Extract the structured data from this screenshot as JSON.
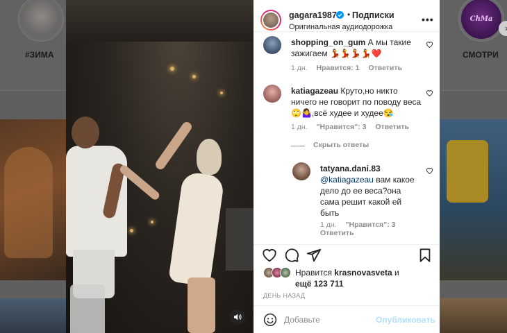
{
  "background": {
    "story_left_label": "#ЗИМА",
    "story_right_label": "СМОТРИ",
    "story_right_logo": "ChMa",
    "next_arrow": "›"
  },
  "post": {
    "author": "gagara1987",
    "separator": "•",
    "follow_label": "Подписки",
    "audio_label": "Оригинальная аудиодорожка",
    "more_label": "•••"
  },
  "comments": [
    {
      "username": "shopping_on_gum",
      "text": "А мы такие зажигаем 💃💃💃💃❤️",
      "time": "1 дн.",
      "likes": "Нравится: 1",
      "reply": "Ответить"
    },
    {
      "username": "katiagazeau",
      "text": "Круто,но никто ничего не говорит по поводу веса🙄🤷‍♀️,всё худее и худее😪",
      "time": "1 дн.",
      "likes": "\"Нравится\": 3",
      "reply": "Ответить"
    }
  ],
  "hide_replies": "Скрыть ответы",
  "reply": {
    "username": "tatyana.dani.83",
    "mention": "@katiagazeau",
    "text": " вам какое дело до ее веса?она сама решит какой ей быть",
    "time": "1 дн.",
    "likes": "\"Нравится\": 3",
    "reply": "Ответить"
  },
  "likes": {
    "prefix": "Нравится ",
    "user": "krasnovasveta",
    "middle": " и",
    "others": "ещё 123 711"
  },
  "date": "ДЕНЬ НАЗАД",
  "add_comment": {
    "placeholder": "Добавьте",
    "publish_label": "Опубликовать"
  },
  "colors": {
    "link": "#00376b",
    "muted": "#8e8e8e",
    "publish_disabled": "#b2dffc",
    "verified": "#0095f6"
  }
}
